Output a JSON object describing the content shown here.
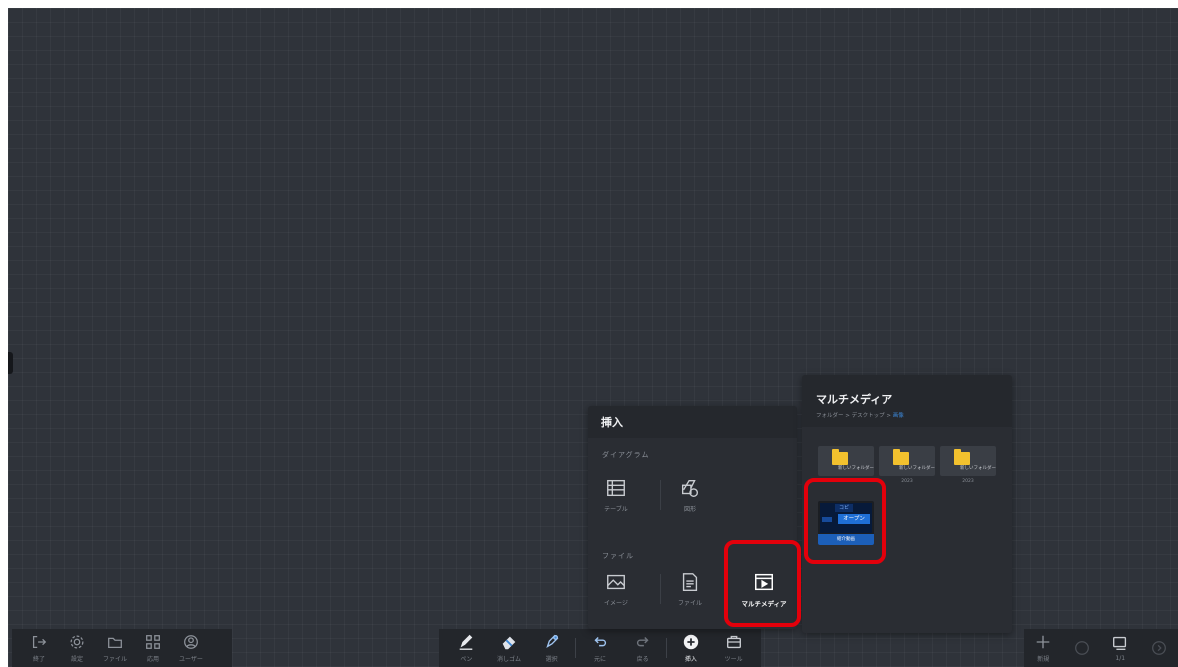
{
  "toolbar_left": {
    "items": [
      {
        "icon": "exit-icon",
        "label": "終了"
      },
      {
        "icon": "gear-icon",
        "label": "設定"
      },
      {
        "icon": "folder-icon",
        "label": "ファイル"
      },
      {
        "icon": "apps-icon",
        "label": "応用"
      },
      {
        "icon": "user-icon",
        "label": "ユーザー"
      }
    ]
  },
  "toolbar_center": {
    "items": [
      {
        "icon": "pen-icon",
        "label": "ペン"
      },
      {
        "icon": "eraser-icon",
        "label": "消しゴム"
      },
      {
        "icon": "select-icon",
        "label": "選択"
      },
      {
        "icon": "undo-icon",
        "label": "元に"
      },
      {
        "icon": "redo-icon",
        "label": "戻る"
      },
      {
        "icon": "insert-icon",
        "label": "挿入"
      },
      {
        "icon": "tools-icon",
        "label": "ツール"
      }
    ]
  },
  "toolbar_right": {
    "items": [
      {
        "icon": "add-page-icon",
        "label": "新規"
      },
      {
        "icon": "info-icon",
        "label": ""
      },
      {
        "icon": "pages-icon",
        "label": "1/1"
      },
      {
        "icon": "next-icon",
        "label": ""
      }
    ]
  },
  "insert_panel": {
    "title": "挿入",
    "section_diagram": "ダイアグラム",
    "table_label": "テーブル",
    "shape_label": "図形",
    "section_file": "ファイル",
    "image_label": "イメージ",
    "file_label": "ファイル",
    "multimedia_label": "マルチメディア"
  },
  "media_panel": {
    "title": "マルチメディア",
    "breadcrumb_path": "フォルダー > デスクトップ > ",
    "breadcrumb_current": "画像",
    "folders": [
      {
        "name": "新しいフォルダー",
        "date": "2023"
      },
      {
        "name": "新しいフォルダー",
        "date": "2023"
      },
      {
        "name": "新しいフォルダー",
        "date": "2023"
      }
    ],
    "video": {
      "top_button": "コピ",
      "main_button": "オープン",
      "caption": "紹介動画"
    }
  },
  "colors": {
    "accent": "#3b86d6",
    "highlight": "#e3000b",
    "folder": "#f2c12e",
    "board": "#2f333a"
  }
}
